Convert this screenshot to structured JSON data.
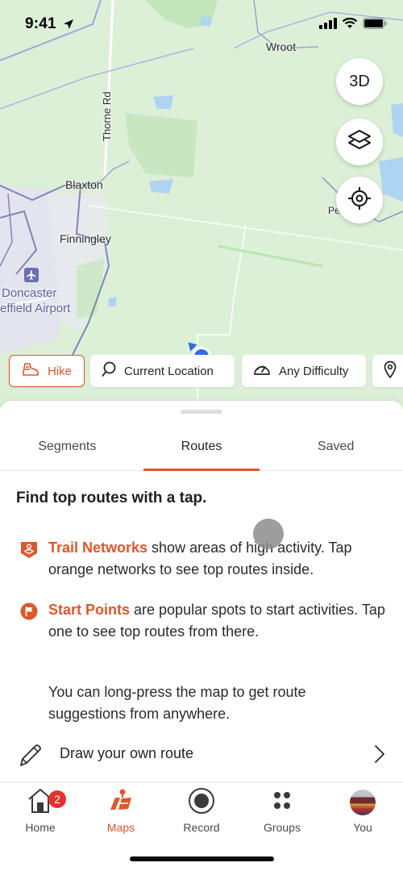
{
  "status_bar": {
    "time": "9:41",
    "icons": [
      "location-arrow-icon",
      "cellular-signal-icon",
      "wifi-icon",
      "battery-icon"
    ]
  },
  "map": {
    "labels": {
      "wroot": "Wroot",
      "thorne_rd": "Thorne Rd",
      "blaxton": "Blaxton",
      "finningley": "Finningley",
      "airport_line1": "Doncaster",
      "airport_line2": "effield Airport",
      "pe": "Pe"
    },
    "buttons": {
      "three_d": "3D",
      "layers": "layers-icon",
      "locate": "locate-icon"
    }
  },
  "filters": {
    "activity": "Hike",
    "location": "Current Location",
    "difficulty": "Any Difficulty"
  },
  "sheet": {
    "tabs": [
      {
        "label": "Segments",
        "active": false
      },
      {
        "label": "Routes",
        "active": true
      },
      {
        "label": "Saved",
        "active": false
      }
    ],
    "headline": "Find top routes with a tap.",
    "trail_networks": {
      "highlight": "Trail Networks",
      "text": " show areas of high activity. Tap orange networks to see top routes inside."
    },
    "start_points": {
      "highlight": "Start Points",
      "text": " are popular spots to start activities. Tap one to see top routes from there."
    },
    "long_press_tip": "You can long-press the map to get route suggestions from anywhere.",
    "draw_route": "Draw your own route"
  },
  "tabbar": {
    "items": [
      {
        "label": "Home",
        "badge": "2",
        "active": false
      },
      {
        "label": "Maps",
        "active": true
      },
      {
        "label": "Record",
        "active": false
      },
      {
        "label": "Groups",
        "active": false
      },
      {
        "label": "You",
        "active": false
      }
    ]
  },
  "colors": {
    "accent": "#e0562a",
    "badge": "#e5322f",
    "user_location": "#2f6fe6",
    "map_land": "#dcf0d8"
  }
}
